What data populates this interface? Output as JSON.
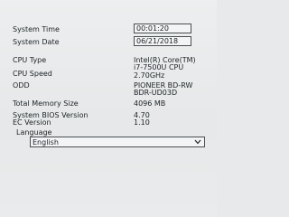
{
  "settings": [
    {
      "label": "System Time",
      "value": "00:01:20",
      "editable": true
    },
    {
      "label": "System Date",
      "value": "06/21/2018",
      "editable": true
    },
    {
      "label": "CPU Type",
      "value": [
        "Intel(R) Core(TM)",
        "i7-7500U CPU"
      ]
    },
    {
      "label": "CPU Speed",
      "value": "2.70GHz"
    },
    {
      "label": "ODD",
      "value": [
        "PIONEER BD-RW",
        "BDR-UD03D"
      ]
    },
    {
      "label": "Total Memory Size",
      "value": "4096 MB"
    },
    {
      "label": "System BIOS Version",
      "value": "4.70"
    },
    {
      "label": "EC Version",
      "value": "1.10"
    }
  ],
  "language": {
    "label": "Language",
    "selected": "English",
    "icon": "chevron-down-icon"
  }
}
